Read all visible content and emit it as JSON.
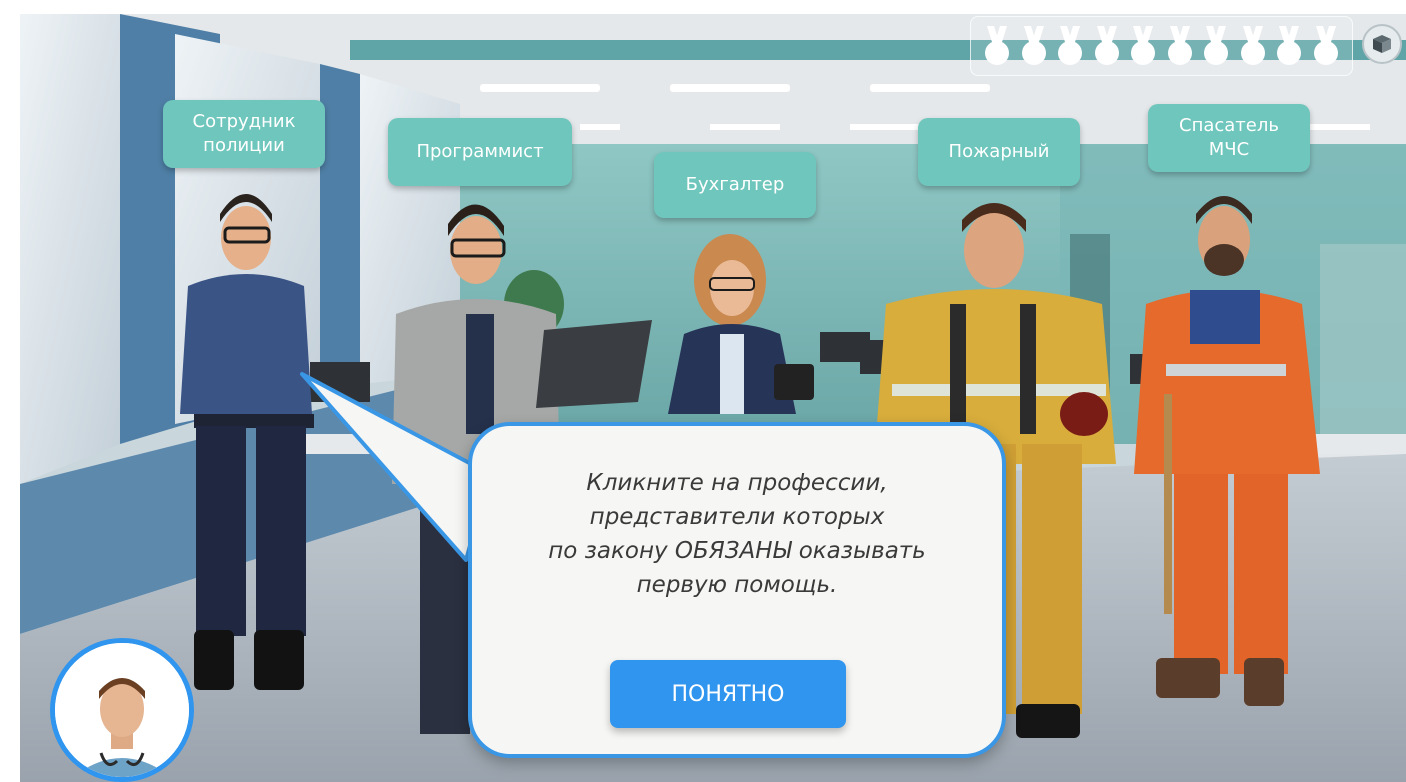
{
  "professions": {
    "police": "Сотрудник\nполиции",
    "programmer": "Программист",
    "accountant": "Бухгалтер",
    "firefighter": "Пожарный",
    "rescuer": "Спасатель\nМЧС"
  },
  "dialog": {
    "text": "Кликните на профессии,\nпредставители которых\nпо закону ОБЯЗАНЫ оказывать\nпервую помощь.",
    "button_label": "ПОНЯТНО"
  },
  "medals": {
    "count": 10
  },
  "icons": {
    "settings": "cube-icon",
    "medal": "medal-icon",
    "avatar": "doctor-avatar"
  },
  "colors": {
    "accent": "#2f95ee",
    "label_bg": "#6fc6bc",
    "dialog_bg": "#f6f6f4"
  }
}
